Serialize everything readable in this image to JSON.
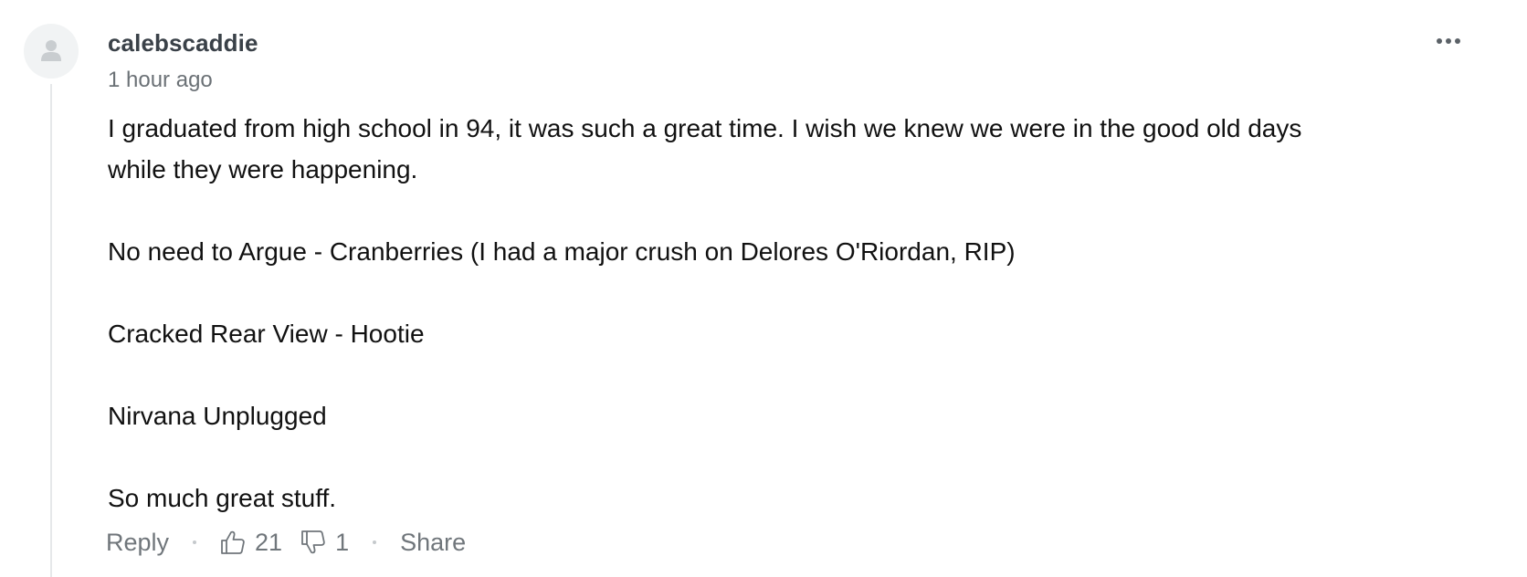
{
  "comment": {
    "author": "calebscaddie",
    "timestamp": "1 hour ago",
    "avatar_icon": "user-silhouette-icon",
    "more_icon": "more-horizontal-icon",
    "paragraphs": [
      "I graduated from high school in 94, it was such a great time. I wish we knew we were in the good old days while they were happening.",
      "No need to Argue - Cranberries (I had a major crush on Delores O'Riordan, RIP)",
      "Cracked Rear View - Hootie",
      "Nirvana Unplugged",
      "So much great stuff."
    ],
    "actions": {
      "reply_label": "Reply",
      "upvote_icon": "thumbs-up-icon",
      "upvotes": "21",
      "downvote_icon": "thumbs-down-icon",
      "downvotes": "1",
      "share_label": "Share"
    }
  },
  "colors": {
    "author": "#3a4148",
    "meta": "#6b7176",
    "body_text": "#111111",
    "thread_line": "#e6e8ea",
    "avatar_bg": "#f1f3f4"
  }
}
